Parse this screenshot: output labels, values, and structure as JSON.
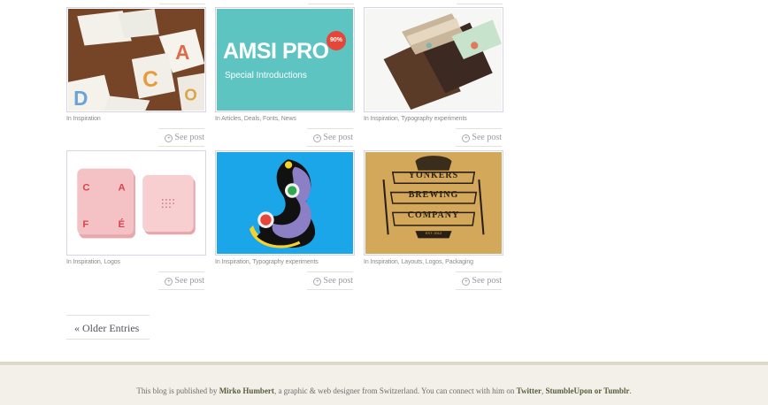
{
  "posts": [
    {
      "categories": "In Inspiration",
      "see_post": "See post",
      "image": "paper-letter-cards-photo"
    },
    {
      "categories": "In Articles, Deals, Fonts, News",
      "see_post": "See post",
      "image": "amsi-pro-banner",
      "banner_title": "AMSI PRO",
      "banner_subtitle": "Special Introductions",
      "badge": "90%"
    },
    {
      "categories": "In Inspiration, Typography experiments",
      "see_post": "See post",
      "image": "chocolate-bar-packaging-photo"
    },
    {
      "categories": "In Inspiration, Logos",
      "see_post": "See post",
      "image": "cafe-coasters-photo"
    },
    {
      "categories": "In Inspiration, Typography experiments",
      "see_post": "See post",
      "image": "colorful-circles-illustration"
    },
    {
      "categories": "In Inspiration, Layouts, Logos, Packaging",
      "see_post": "See post",
      "image": "yonkers-brewing-logo",
      "logo_lines": [
        "YONKERS",
        "BREWING",
        "COMPANY"
      ],
      "logo_est": "EST. 2012"
    }
  ],
  "pagination": {
    "older_entries": "« Older Entries"
  },
  "footer": {
    "text_1": "This blog is published by ",
    "author": "Mirko Humbert",
    "text_2": ", a graphic & web designer from Switzerland. You can connect with him on ",
    "twitter": "Twitter",
    "text_3": ", ",
    "others": "StumbleUpon or Tumblr",
    "text_4": "."
  },
  "colors": {
    "accent": "#555f3a",
    "footer_bg": "#f2f0e9",
    "footer_border": "#ddd9c3"
  }
}
